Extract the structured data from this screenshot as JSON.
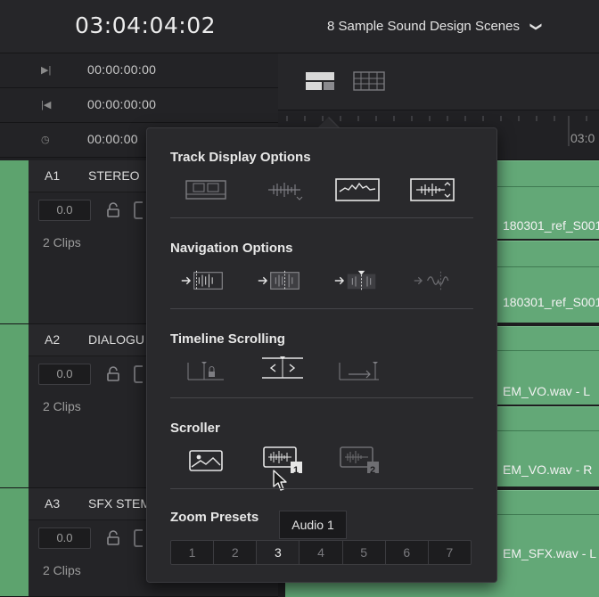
{
  "header": {
    "timecode": "03:04:04:02",
    "timeline_name": "8 Sample Sound Design Scenes",
    "chevron": "❯"
  },
  "timecodes": [
    {
      "icon": "in-point-icon",
      "glyph": "▶|",
      "value": "00:00:00:00"
    },
    {
      "icon": "out-point-icon",
      "glyph": "|◀",
      "value": "00:00:00:00"
    },
    {
      "icon": "clock-icon",
      "glyph": "◷",
      "value": "00:00:00"
    }
  ],
  "tracks": [
    {
      "id": "A1",
      "name": "STEREO",
      "volume": "0.0",
      "clips": "2 Clips"
    },
    {
      "id": "A2",
      "name": "DIALOGU",
      "volume": "0.0",
      "clips": "2 Clips"
    },
    {
      "id": "A3",
      "name": "SFX STEM",
      "volume": "0.0",
      "clips": "2 Clips"
    }
  ],
  "ruler": {
    "timecode": "03:0"
  },
  "clips": [
    {
      "label": "180301_ref_S001"
    },
    {
      "label": "180301_ref_S001"
    },
    {
      "label": "EM_VO.wav - L"
    },
    {
      "label": "EM_VO.wav - R"
    },
    {
      "label": "EM_SFX.wav - L"
    }
  ],
  "popup": {
    "sections": [
      {
        "title": "Track Display Options"
      },
      {
        "title": "Navigation Options"
      },
      {
        "title": "Timeline Scrolling"
      },
      {
        "title": "Scroller"
      },
      {
        "title": "Zoom Presets"
      }
    ],
    "zoom_presets": [
      "1",
      "2",
      "3",
      "4",
      "5",
      "6",
      "7"
    ],
    "active_zoom_preset": "3",
    "tooltip": "Audio 1",
    "scroller_badges": [
      "1",
      "2"
    ]
  },
  "colors": {
    "track_green": "#5da36e",
    "clip_green": "#63a877",
    "panel_bg": "#29292c"
  }
}
